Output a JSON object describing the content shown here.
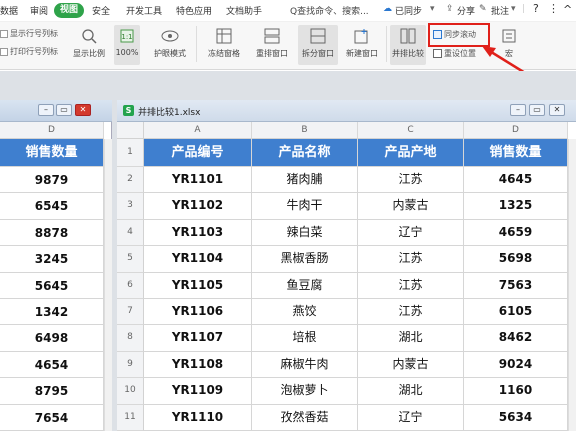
{
  "menu": {
    "items": [
      "数据",
      "审阅",
      "视图",
      "安全",
      "开发工具",
      "特色应用",
      "文档助手"
    ],
    "active": "视图",
    "search": "Q查找命令、搜索...",
    "sync": "已同步",
    "share": "分享",
    "annotate": "批注",
    "help": "?",
    "more": "⋮",
    "collapse": "^"
  },
  "ribbon": {
    "show_row_col": "显示行号列标",
    "print_row_col": "打印行号列标",
    "zoom": "显示比例",
    "zoom_100": "100%",
    "eye_mode": "护眼模式",
    "freeze": "冻结窗格",
    "rearrange": "重排窗口",
    "split": "拆分窗口",
    "new_window": "新建窗口",
    "side_by_side": "并排比较",
    "sync_scroll": "同步滚动",
    "reset_position": "重设位置",
    "macro": "宏"
  },
  "left_window": {
    "col_letter": "D",
    "header": "销售数量",
    "values": [
      "9879",
      "6545",
      "8878",
      "3245",
      "5645",
      "1342",
      "6498",
      "4654",
      "8795",
      "7654"
    ]
  },
  "right_window": {
    "title": "并排比较1.xlsx",
    "col_letters": [
      "A",
      "B",
      "C",
      "D"
    ],
    "headers": [
      "产品编号",
      "产品名称",
      "产品产地",
      "销售数量"
    ],
    "row_numbers": [
      "1",
      "2",
      "3",
      "4",
      "5",
      "6",
      "7",
      "8",
      "9",
      "10",
      "11"
    ],
    "rows": [
      [
        "YR1101",
        "猪肉脯",
        "江苏",
        "4645"
      ],
      [
        "YR1102",
        "牛肉干",
        "内蒙古",
        "1325"
      ],
      [
        "YR1103",
        "辣白菜",
        "辽宁",
        "4659"
      ],
      [
        "YR1104",
        "黑椒香肠",
        "江苏",
        "5698"
      ],
      [
        "YR1105",
        "鱼豆腐",
        "江苏",
        "7563"
      ],
      [
        "YR1106",
        "燕饺",
        "江苏",
        "6105"
      ],
      [
        "YR1107",
        "培根",
        "湖北",
        "8462"
      ],
      [
        "YR1108",
        "麻椒牛肉",
        "内蒙古",
        "9024"
      ],
      [
        "YR1109",
        "泡椒萝卜",
        "湖北",
        "1160"
      ],
      [
        "YR1110",
        "孜然香菇",
        "辽宁",
        "5634"
      ]
    ]
  },
  "colors": {
    "header_fill": "#3f7fcf",
    "active_tab": "#2fa34a",
    "annotation": "#e0201a"
  }
}
